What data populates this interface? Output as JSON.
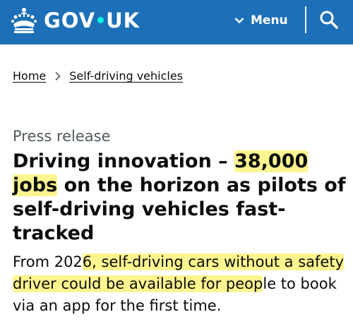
{
  "header": {
    "logo_text_left": "GOV",
    "logo_text_right": "UK",
    "menu_label": "Menu",
    "crown_icon": "crown-icon",
    "search_icon": "search-icon",
    "brand_color": "#1d70b8",
    "dot_color": "#00ffe0"
  },
  "breadcrumb": {
    "items": [
      "Home",
      "Self-driving vehicles"
    ]
  },
  "article": {
    "caption": "Press release",
    "title_part1": "Driving innovation – ",
    "title_highlight": "38,000 jobs",
    "title_part2": " on the horizon as pilots of self-driving vehicles fast-tracked",
    "lede_part1": "From 202",
    "lede_highlight": "6, self-driving cars without a safety driver could be available for peop",
    "lede_part2": "le to book via an app for the first time.",
    "highlight_color": "#fdf58f"
  }
}
